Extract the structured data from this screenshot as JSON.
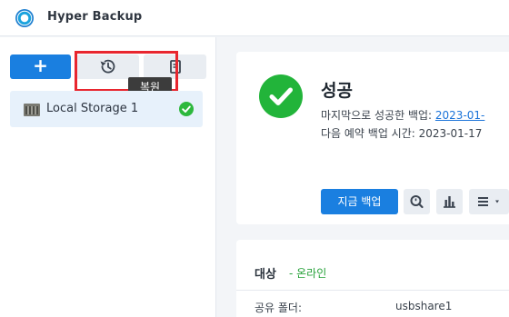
{
  "app": {
    "title": "Hyper Backup"
  },
  "sidebar": {
    "tooltip": "복원",
    "tasks": [
      {
        "label": "Local Storage 1",
        "status_color": "#2db83d"
      }
    ]
  },
  "status": {
    "title": "성공",
    "last_backup_label": "마지막으로 성공한 백업:",
    "last_backup_value": "2023-01-",
    "next_backup_label": "다음 예약 백업 시간:",
    "next_backup_value": "2023-01-17",
    "backup_now_label": "지금 백업"
  },
  "target": {
    "title": "대상",
    "status": "- 온라인",
    "shared_folder_label": "공유 폴더:",
    "shared_folder_value": "usbshare1"
  },
  "colors": {
    "accent": "#1a7fe0",
    "success": "#22b43a",
    "highlight": "#e8262f"
  }
}
